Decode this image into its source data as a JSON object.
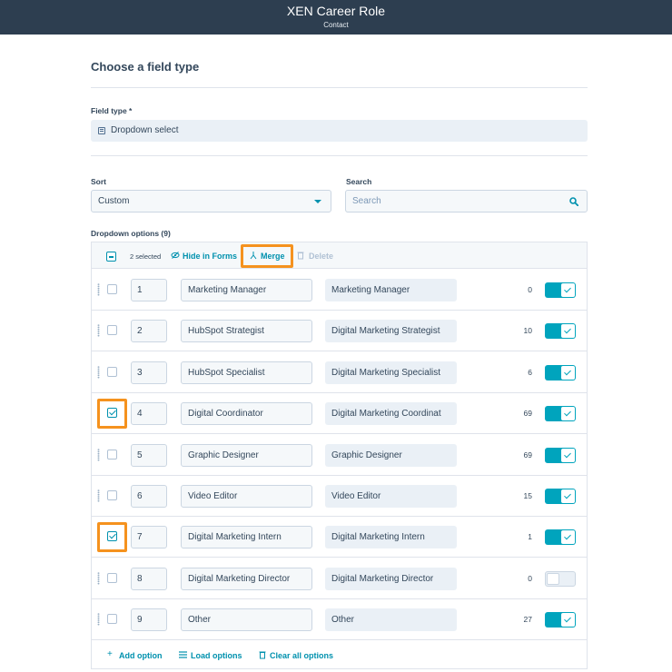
{
  "header": {
    "title": "XEN Career Role",
    "subtitle": "Contact"
  },
  "page": {
    "heading": "Choose a field type"
  },
  "field_type": {
    "label": "Field type *",
    "value": "Dropdown select"
  },
  "sort": {
    "label": "Sort",
    "value": "Custom"
  },
  "search": {
    "label": "Search",
    "placeholder": "Search"
  },
  "options": {
    "title": "Dropdown options (9)",
    "toolbar": {
      "selected_count": "2 selected",
      "hide_label": "Hide in Forms",
      "merge_label": "Merge",
      "delete_label": "Delete"
    },
    "rows": [
      {
        "order": "1",
        "label": "Marketing Manager",
        "internal_value": "Marketing Manager",
        "count": "0",
        "checked": false,
        "visible": true
      },
      {
        "order": "2",
        "label": "HubSpot Strategist",
        "internal_value": "Digital Marketing Strategist",
        "count": "10",
        "checked": false,
        "visible": true
      },
      {
        "order": "3",
        "label": "HubSpot Specialist",
        "internal_value": "Digital Marketing Specialist",
        "count": "6",
        "checked": false,
        "visible": true
      },
      {
        "order": "4",
        "label": "Digital Coordinator",
        "internal_value": "Digital Marketing Coordinat",
        "count": "69",
        "checked": true,
        "visible": true
      },
      {
        "order": "5",
        "label": "Graphic Designer",
        "internal_value": "Graphic Designer",
        "count": "69",
        "checked": false,
        "visible": true
      },
      {
        "order": "6",
        "label": "Video Editor",
        "internal_value": "Video Editor",
        "count": "15",
        "checked": false,
        "visible": true
      },
      {
        "order": "7",
        "label": "Digital Marketing Intern",
        "internal_value": "Digital Marketing Intern",
        "count": "1",
        "checked": true,
        "visible": true
      },
      {
        "order": "8",
        "label": "Digital Marketing Director",
        "internal_value": "Digital Marketing Director",
        "count": "0",
        "checked": false,
        "visible": false
      },
      {
        "order": "9",
        "label": "Other",
        "internal_value": "Other",
        "count": "27",
        "checked": false,
        "visible": true
      }
    ],
    "footer": {
      "add_label": "Add option",
      "load_label": "Load options",
      "clear_label": "Clear all options"
    }
  },
  "colors": {
    "accent": "#0091ae",
    "toggle_on": "#00a4bd",
    "highlight": "#f5921e",
    "header_bg": "#2d3e50"
  }
}
